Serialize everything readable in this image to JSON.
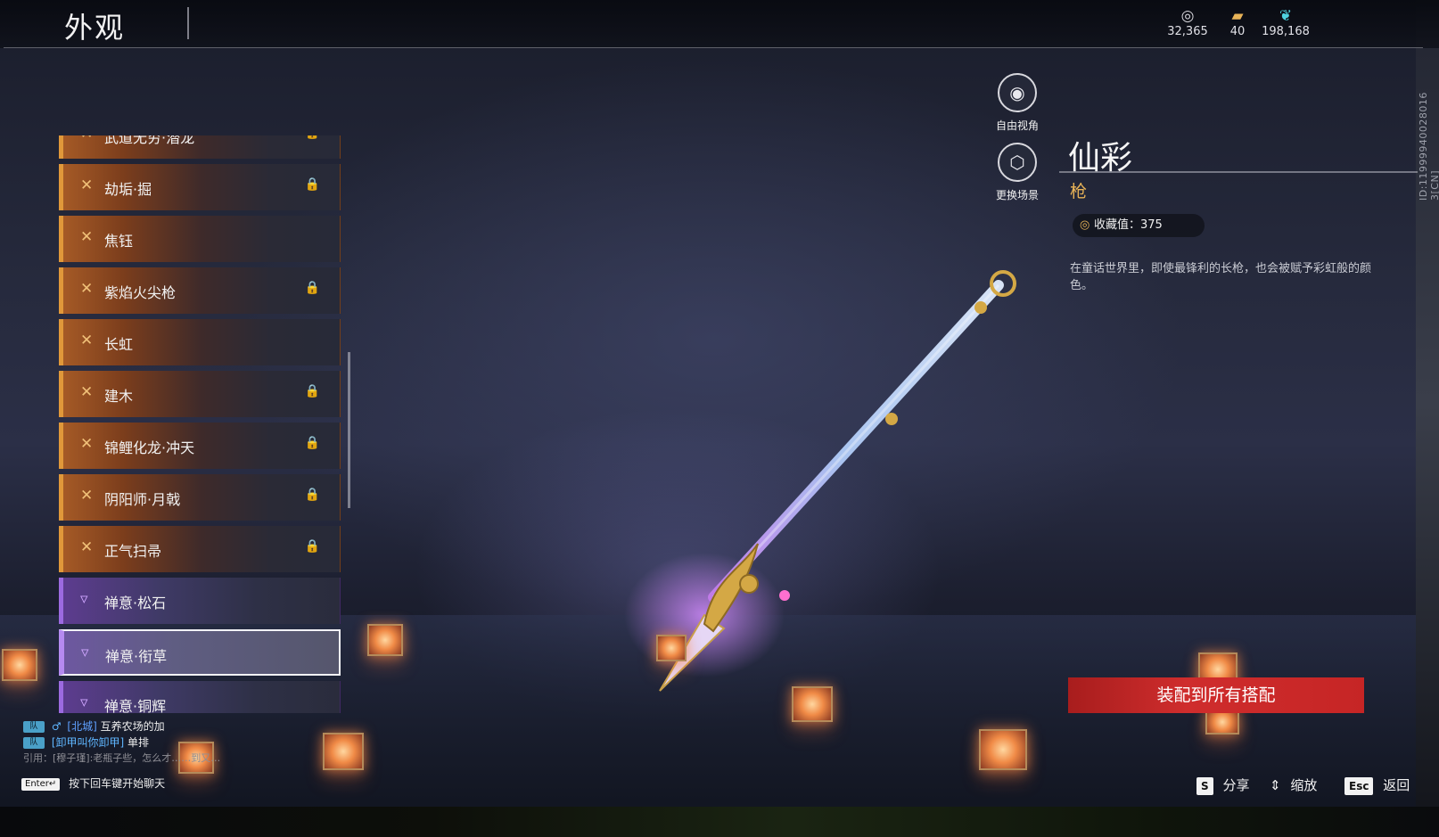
{
  "header": {
    "title": "外观",
    "currencies": [
      {
        "icon": "shell-currency-icon",
        "glyph": "◎",
        "value": "32,365"
      },
      {
        "icon": "ticket-currency-icon",
        "glyph": "▰",
        "value": "40"
      },
      {
        "icon": "feather-currency-icon",
        "glyph": "❦",
        "value": "198,168"
      }
    ]
  },
  "side_id": "ID:11999940028016 3[CN]",
  "list": {
    "items": [
      {
        "label": "武道无穷·潜龙",
        "rarity": "orange",
        "locked": true
      },
      {
        "label": "劫垢·掘",
        "rarity": "orange",
        "locked": true
      },
      {
        "label": "焦钰",
        "rarity": "orange",
        "locked": false
      },
      {
        "label": "紫焰火尖枪",
        "rarity": "orange",
        "locked": true
      },
      {
        "label": "长虹",
        "rarity": "orange",
        "locked": false
      },
      {
        "label": "建木",
        "rarity": "orange",
        "locked": true
      },
      {
        "label": "锦鲤化龙·冲天",
        "rarity": "orange",
        "locked": true
      },
      {
        "label": "阴阳师·月戟",
        "rarity": "orange",
        "locked": true
      },
      {
        "label": "正气扫帚",
        "rarity": "orange",
        "locked": true
      },
      {
        "label": "禅意·松石",
        "rarity": "purple",
        "locked": false
      },
      {
        "label": "禅意·衔草",
        "rarity": "purple",
        "locked": false,
        "selected": true
      },
      {
        "label": "禅意·铜辉",
        "rarity": "purple",
        "locked": false
      }
    ]
  },
  "view_buttons": {
    "free_view": "自由视角",
    "change_scene": "更换场景"
  },
  "detail": {
    "name": "仙彩",
    "type": "枪",
    "collect_value": "收藏值：375",
    "description": "在童话世界里，即使最锋利的长枪，也会被赋予彩虹般的颜色。",
    "equip_button": "装配到所有搭配"
  },
  "chat": {
    "lines": [
      {
        "tag": "队",
        "gender": "♂",
        "channel": "[北城]",
        "text": "互养农场的加"
      },
      {
        "tag": "队",
        "gender": "",
        "channel": "",
        "name": "[卸甲叫你卸甲]",
        "text": "单排"
      }
    ],
    "quote": "引用：[穆子瑾]:老瓶子些，怎么才……到又…",
    "enter_key": "Enter↵",
    "enter_hint": "按下回车键开始聊天"
  },
  "hotkeys": [
    {
      "key": "S",
      "label": "分享"
    },
    {
      "key": "",
      "label": "缩放",
      "icon": "zoom-icon"
    },
    {
      "key": "Esc",
      "label": "返回"
    }
  ],
  "colors": {
    "accent_gold": "#e8b357",
    "equip_red": "#c62525",
    "rarity_orange": "#e0983a",
    "rarity_purple": "#9c6ae0"
  }
}
